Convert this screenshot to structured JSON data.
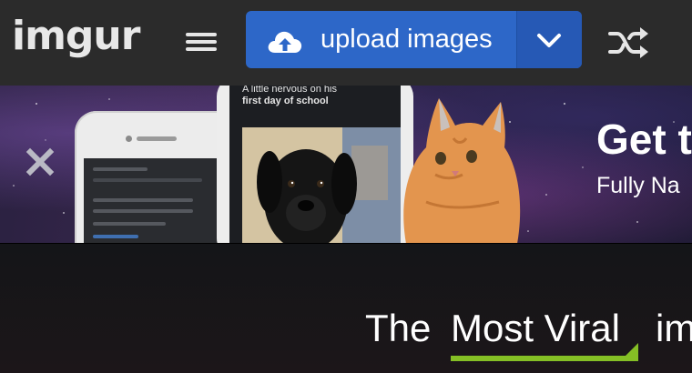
{
  "header": {
    "logo_text": "imgur",
    "menu_icon": "hamburger-menu-icon",
    "upload": {
      "label": "upload images",
      "icon": "cloud-upload-icon",
      "caret_icon": "chevron-down-icon"
    },
    "shuffle_icon": "shuffle-icon",
    "colors": {
      "bar": "#2b2b2b",
      "upload_button": "#2d67c8",
      "upload_caret": "#2659b5"
    }
  },
  "banner": {
    "close_icon": "close-icon",
    "phone_caption_line1": "A little nervous on his",
    "phone_caption_line2": "first day of school",
    "title": "Get t",
    "subtitle": "Fully Na"
  },
  "sort": {
    "prefix": "The",
    "selected": "Most Viral",
    "suffix": "im",
    "accent_color": "#85bf25"
  }
}
